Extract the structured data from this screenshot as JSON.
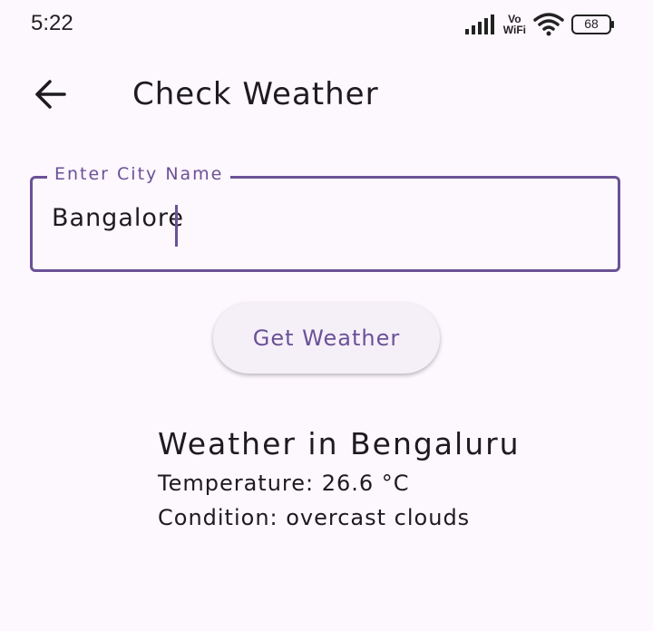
{
  "status_bar": {
    "time": "5:22",
    "vowifi_top": "Vo",
    "vowifi_bottom": "WiFi",
    "battery": "68"
  },
  "app_bar": {
    "title": "Check Weather",
    "back_icon": "arrow-back-icon"
  },
  "city_field": {
    "label": "Enter City Name",
    "value": "Bangalore"
  },
  "actions": {
    "get_weather_label": "Get Weather"
  },
  "result": {
    "title": "Weather in Bengaluru",
    "temperature": "Temperature: 26.6 °C",
    "condition": "Condition: overcast clouds"
  },
  "colors": {
    "background": "#fdf7fe",
    "accent": "#6a5197",
    "text": "#1d1b20",
    "button_bg": "#f5f0f8"
  }
}
